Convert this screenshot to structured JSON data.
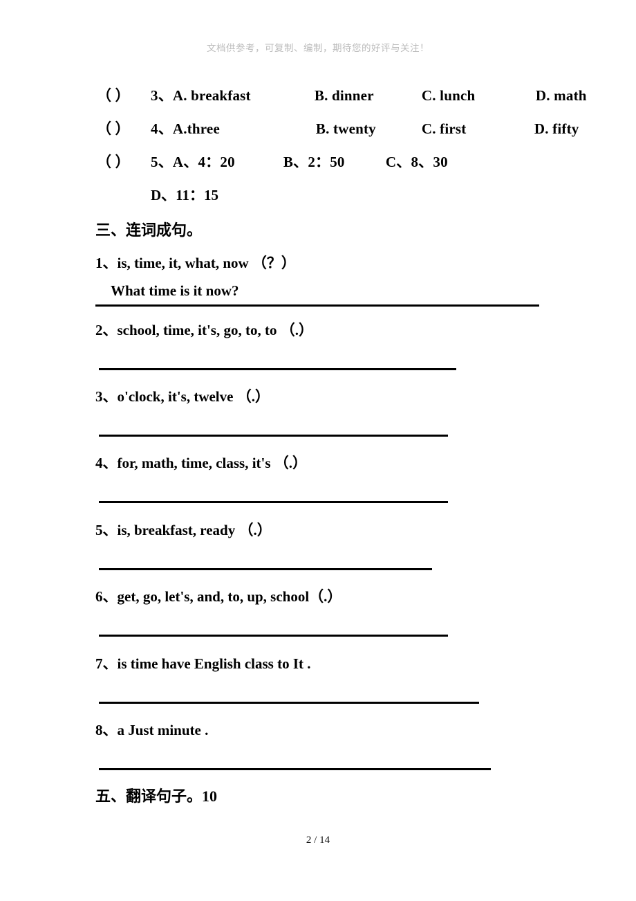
{
  "watermark": "文档供参考，可复制、编制，期待您的好评与关注！",
  "multiple_choice": {
    "questions": [
      {
        "bracket": "（    ）",
        "number": "3、",
        "options": [
          "A. breakfast",
          "B. dinner",
          "C. lunch",
          "D. math"
        ]
      },
      {
        "bracket": "（    ）",
        "number": "4、",
        "options": [
          "A.three",
          "B. twenty",
          "C. first",
          "D. fifty"
        ]
      },
      {
        "bracket": "（    ）",
        "number": "5、",
        "options": [
          "A、4：20",
          "B、2：50",
          "C、8、30"
        ],
        "continuation": "D、11：15"
      }
    ]
  },
  "section_three": {
    "heading_cjk": "三、连词成句。",
    "heading_num": "",
    "items": [
      {
        "number": "1、",
        "words": "is,   time,   it,   what, now   （？）",
        "answer": "What time   is   it   now?"
      },
      {
        "number": "2、",
        "words": "school,   time,   it's,   go,   to,   to  （.）",
        "answer": ""
      },
      {
        "number": "3、",
        "words": "o'clock,   it's,   twelve    （.）",
        "answer": ""
      },
      {
        "number": "4、",
        "words": "for,   math,   time,   class,   it's  （.）",
        "answer": ""
      },
      {
        "number": "5、",
        "words": "is,   breakfast,   ready   （.）",
        "answer": ""
      },
      {
        "number": "6、",
        "words": "get, go, let's, and, to, up, school（.）",
        "answer": ""
      },
      {
        "number": "7、",
        "words": "is   time   have   English   class   to   It .",
        "answer": ""
      },
      {
        "number": "8、",
        "words": "a      Just      minute  .",
        "answer": ""
      }
    ]
  },
  "section_five": {
    "heading_cjk": "五、翻译句子。",
    "heading_num": "10"
  },
  "footer": {
    "page_label": "2  / 14"
  }
}
